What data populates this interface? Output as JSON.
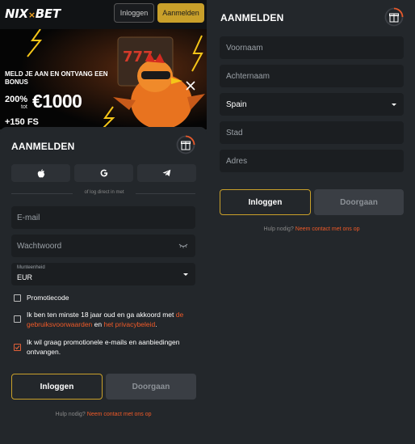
{
  "header": {
    "logo": {
      "left": "NIX",
      "sep": "×",
      "right": "BET"
    },
    "login_label": "Inloggen",
    "register_label": "Aanmelden"
  },
  "promo": {
    "headline": "MELD JE AAN EN ONTVANG EEN BONUS",
    "percent": "200%",
    "tot": "tot",
    "amount": "€1000",
    "free_spins": "+150 FS"
  },
  "left_form": {
    "title": "AANMELDEN",
    "social": [
      "apple-icon",
      "google-icon",
      "telegram-icon"
    ],
    "divider_text": "of log direct in met",
    "email_placeholder": "E-mail",
    "password_placeholder": "Wachtwoord",
    "currency_label": "Munteenheid",
    "currency_value": "EUR",
    "promo_code": "Promotiecode",
    "terms": {
      "text1": "Ik ben ten minste 18 jaar oud en ga akkoord met",
      "link1": "de gebruiksvoorwaarden",
      "and": " en ",
      "link2": "het privacybeleid",
      "dot": "."
    },
    "marketing": "Ik wil graag promotionele e-mails en aanbiedingen ontvangen.",
    "login_button": "Inloggen",
    "next_button": "Doorgaan",
    "help_text": "Hulp nodig?",
    "help_link": "Neem contact met ons op"
  },
  "right_form": {
    "title": "AANMELDEN",
    "first_name": "Voornaam",
    "last_name": "Achternaam",
    "country": "Spain",
    "city": "Stad",
    "address": "Adres",
    "login_button": "Inloggen",
    "next_button": "Doorgaan",
    "help_text": "Hulp nodig?",
    "help_link": "Neem contact met ons op"
  },
  "colors": {
    "accent": "#c9a02a",
    "link": "#f05a28",
    "panel": "#23272b",
    "field": "#1b1e21"
  }
}
